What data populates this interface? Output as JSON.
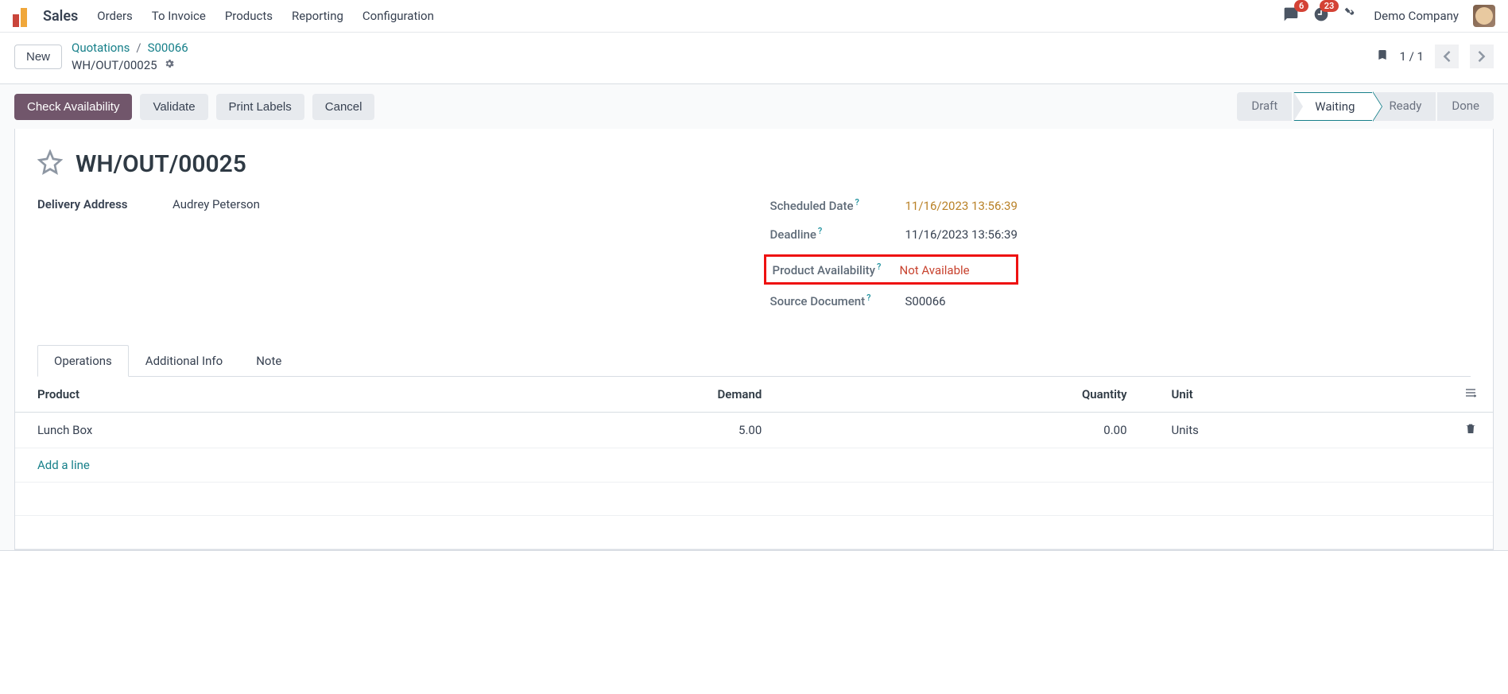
{
  "topnav": {
    "app": "Sales",
    "links": [
      "Orders",
      "To Invoice",
      "Products",
      "Reporting",
      "Configuration"
    ],
    "messages_badge": "6",
    "activities_badge": "23",
    "company": "Demo Company"
  },
  "breadcrumb": {
    "new_label": "New",
    "items": [
      "Quotations",
      "S00066"
    ],
    "record": "WH/OUT/00025",
    "pager": "1 / 1"
  },
  "actions": {
    "check_availability": "Check Availability",
    "validate": "Validate",
    "print_labels": "Print Labels",
    "cancel": "Cancel"
  },
  "status": {
    "steps": [
      "Draft",
      "Waiting",
      "Ready",
      "Done"
    ],
    "active": "Waiting"
  },
  "doc": {
    "title": "WH/OUT/00025",
    "delivery_address_label": "Delivery Address",
    "delivery_address_value": "Audrey Peterson",
    "scheduled_date_label": "Scheduled Date",
    "scheduled_date_value": "11/16/2023 13:56:39",
    "deadline_label": "Deadline",
    "deadline_value": "11/16/2023 13:56:39",
    "product_availability_label": "Product Availability",
    "product_availability_value": "Not Available",
    "source_doc_label": "Source Document",
    "source_doc_value": "S00066"
  },
  "tabs": [
    "Operations",
    "Additional Info",
    "Note"
  ],
  "table": {
    "headers": {
      "product": "Product",
      "demand": "Demand",
      "quantity": "Quantity",
      "unit": "Unit"
    },
    "rows": [
      {
        "product": "Lunch Box",
        "demand": "5.00",
        "quantity": "0.00",
        "unit": "Units"
      }
    ],
    "add_line": "Add a line"
  }
}
